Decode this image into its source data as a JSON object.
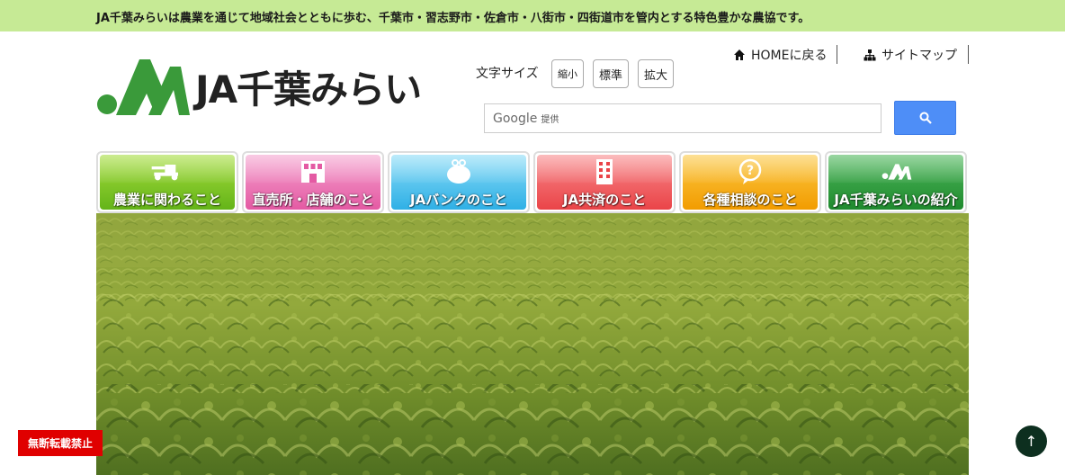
{
  "topbar": {
    "text": "JA千葉みらいは農業を通じて地域社会とともに歩む、千葉市・習志野市・佐倉市・八街市・四街道市を管内とする特色豊かな農協です。",
    "bg_color": "#c6ea95"
  },
  "logo": {
    "text": "JA千葉みらい",
    "icon": "ja-logo-icon",
    "brand_color": "#3a9a3a"
  },
  "utility": {
    "home_label": "HOMEに戻る",
    "home_icon": "home-icon",
    "sitemap_label": "サイトマップ",
    "sitemap_icon": "sitemap-icon"
  },
  "font_size": {
    "label": "文字サイズ",
    "small": "縮小",
    "standard": "標準",
    "large": "拡大"
  },
  "search": {
    "brand": "Google",
    "brand_sub": "提供",
    "placeholder": "",
    "button_icon": "search-icon",
    "button_color": "#4e8ef7"
  },
  "nav": [
    {
      "label": "農業に関わること",
      "icon": "tractor-icon",
      "color": "#7cc61e"
    },
    {
      "label": "直売所・店舗のこと",
      "icon": "store-icon",
      "color": "#ea6fb0"
    },
    {
      "label": "JAバンクのこと",
      "icon": "wallet-icon",
      "color": "#37b8ea"
    },
    {
      "label": "JA共済のこと",
      "icon": "building-icon",
      "color": "#ef5054"
    },
    {
      "label": "各種相談のこと",
      "icon": "question-bubble-icon",
      "color": "#f6a200"
    },
    {
      "label": "JA千葉みらいの紹介",
      "icon": "ja-logo-icon",
      "color": "#2e9a3e"
    }
  ],
  "hero": {
    "image": "carrot-field-photo"
  },
  "badge": {
    "no_reproduction": "無断転載禁止"
  },
  "to_top": {
    "label": "↑"
  }
}
